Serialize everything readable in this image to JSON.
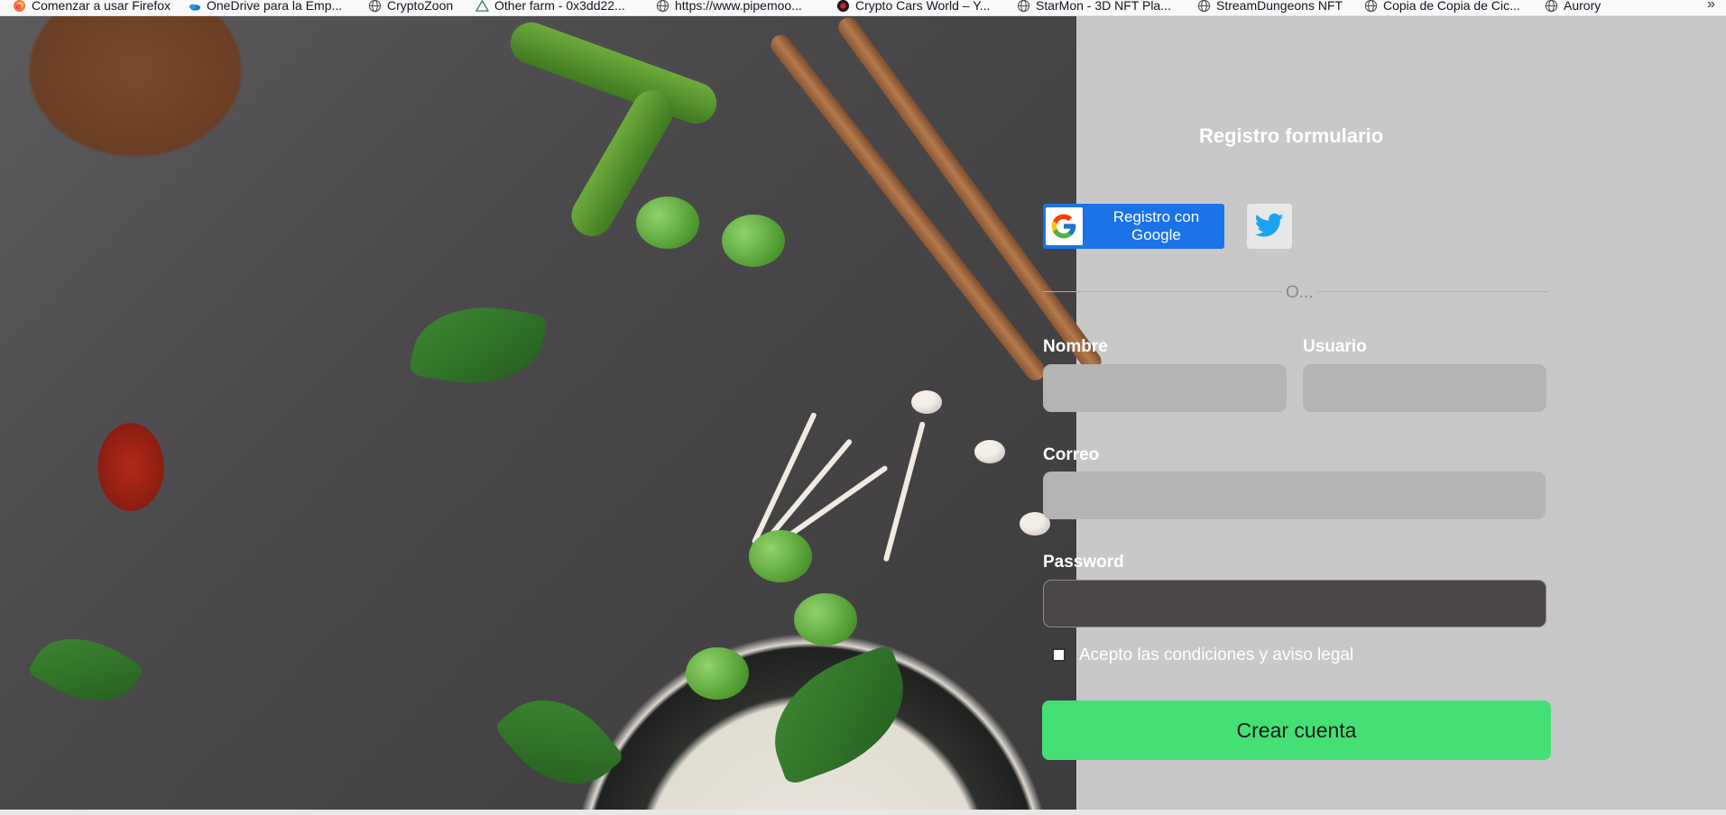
{
  "bookmarks": [
    {
      "label": "Comenzar a usar Firefox",
      "icon": "firefox-icon"
    },
    {
      "label": "OneDrive para la Emp...",
      "icon": "onedrive-icon"
    },
    {
      "label": "CryptoZoon",
      "icon": "globe-icon"
    },
    {
      "label": "Other farm - 0x3dd22...",
      "icon": "triangle-icon"
    },
    {
      "label": "https://www.pipemoo...",
      "icon": "globe-icon"
    },
    {
      "label": "Crypto Cars World – Y...",
      "icon": "cryptocars-icon"
    },
    {
      "label": "StarMon - 3D NFT Pla...",
      "icon": "globe-icon"
    },
    {
      "label": "StreamDungeons NFT",
      "icon": "globe-icon"
    },
    {
      "label": "Copia de Copia de Cic...",
      "icon": "globe-icon"
    },
    {
      "label": "Aurory",
      "icon": "globe-icon"
    }
  ],
  "bookmarks_overflow": "»",
  "form": {
    "title": "Registro formulario",
    "google_label": "Registro con Google",
    "divider_text": "O...",
    "nombre_label": "Nombre",
    "nombre_value": "",
    "usuario_label": "Usuario",
    "usuario_value": "",
    "correo_label": "Correo",
    "correo_value": "",
    "password_label": "Password",
    "password_value": "",
    "terms_label": "Acepto las condiciones y aviso legal",
    "terms_checked": false,
    "submit_label": "Crear cuenta"
  },
  "colors": {
    "panel_bg": "#c8c8c8",
    "google_blue": "#1a73e8",
    "twitter_blue": "#1da1f2",
    "submit_green": "#44e076"
  }
}
